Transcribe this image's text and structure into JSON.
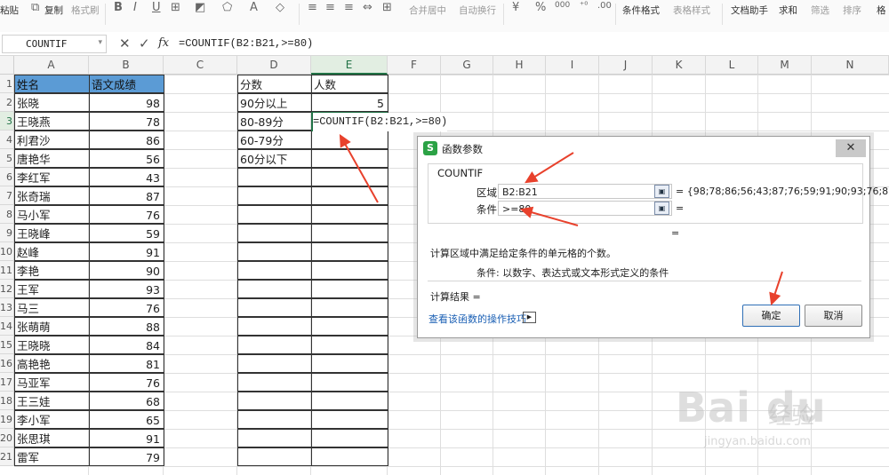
{
  "ribbon": {
    "items": [
      {
        "label": "粘贴",
        "dim": false
      },
      {
        "label": "复制",
        "dim": false
      },
      {
        "label": "格式刷",
        "dim": true
      },
      {
        "label": "合并居中",
        "dim": true
      },
      {
        "label": "自动换行",
        "dim": true
      },
      {
        "label": "条件格式",
        "dim": false
      },
      {
        "label": "表格样式",
        "dim": true
      },
      {
        "label": "文档助手",
        "dim": false
      },
      {
        "label": "求和",
        "dim": false
      },
      {
        "label": "筛选",
        "dim": true
      },
      {
        "label": "排序",
        "dim": true
      },
      {
        "label": "格",
        "dim": false
      }
    ],
    "format_icons": [
      "B",
      "I",
      "U",
      "⊞",
      "◩",
      "⬠",
      "A",
      "◇",
      "≡",
      "≡",
      "≡",
      "⇔",
      "⊞",
      "¥",
      "%",
      "000",
      "⁺⁰",
      ".00"
    ]
  },
  "formula_bar": {
    "name_box": "COUNTIF",
    "cancel_icon": "✕",
    "confirm_icon": "✓",
    "fx": "fx",
    "formula": "=COUNTIF(B2:B21,>=80)"
  },
  "sheet": {
    "columns": [
      "A",
      "B",
      "C",
      "D",
      "E",
      "F",
      "G",
      "H",
      "I",
      "J",
      "K",
      "L",
      "M",
      "N"
    ],
    "row_numbers": [
      "1",
      "2",
      "3",
      "4",
      "5",
      "6",
      "7",
      "8",
      "9",
      "10",
      "11",
      "12",
      "13",
      "14",
      "15",
      "16",
      "17",
      "18",
      "19",
      "20",
      "21"
    ],
    "header": {
      "name": "姓名",
      "score": "语文成绩",
      "range": "分数",
      "count": "人数"
    },
    "students": [
      {
        "name": "张晓",
        "score": "98"
      },
      {
        "name": "王晓燕",
        "score": "78"
      },
      {
        "name": "利君沙",
        "score": "86"
      },
      {
        "name": "唐艳华",
        "score": "56"
      },
      {
        "name": "李红军",
        "score": "43"
      },
      {
        "name": "张奇瑞",
        "score": "87"
      },
      {
        "name": "马小军",
        "score": "76"
      },
      {
        "name": "王晓峰",
        "score": "59"
      },
      {
        "name": "赵峰",
        "score": "91"
      },
      {
        "name": "李艳",
        "score": "90"
      },
      {
        "name": "王军",
        "score": "93"
      },
      {
        "name": "马三",
        "score": "76"
      },
      {
        "name": "张萌萌",
        "score": "88"
      },
      {
        "name": "王晓晓",
        "score": "84"
      },
      {
        "name": "高艳艳",
        "score": "81"
      },
      {
        "name": "马亚军",
        "score": "76"
      },
      {
        "name": "王三娃",
        "score": "68"
      },
      {
        "name": "李小军",
        "score": "65"
      },
      {
        "name": "张思琪",
        "score": "91"
      },
      {
        "name": "雷军",
        "score": "79"
      }
    ],
    "ranges": [
      {
        "label": "90分以上",
        "count": "5"
      },
      {
        "label": "80-89分",
        "count": ""
      },
      {
        "label": "60-79分",
        "count": ""
      },
      {
        "label": "60分以下",
        "count": ""
      }
    ],
    "editing_text": "=COUNTIF(B2:B21,>=80)"
  },
  "dialog": {
    "title": "函数参数",
    "function_name": "COUNTIF",
    "range_label": "区域",
    "range_value": "B2:B21",
    "range_result": "= {98;78;86;56;43;87;76;59;91;90;93;76;8...",
    "criteria_label": "条件",
    "criteria_value": ">=80",
    "criteria_result": "=",
    "total_result": "=",
    "description": "计算区域中满足给定条件的单元格的个数。",
    "arg_help": "条件:  以数字、表达式或文本形式定义的条件",
    "calc_result_label": "计算结果 =",
    "help_link": "查看该函数的操作技巧",
    "ok": "确定",
    "cancel": "取消",
    "close": "✕"
  },
  "watermark": {
    "brand": "Bai du",
    "suffix": "经验",
    "url": "jingyan.baidu.com"
  },
  "annotation_color": "#e8412c"
}
